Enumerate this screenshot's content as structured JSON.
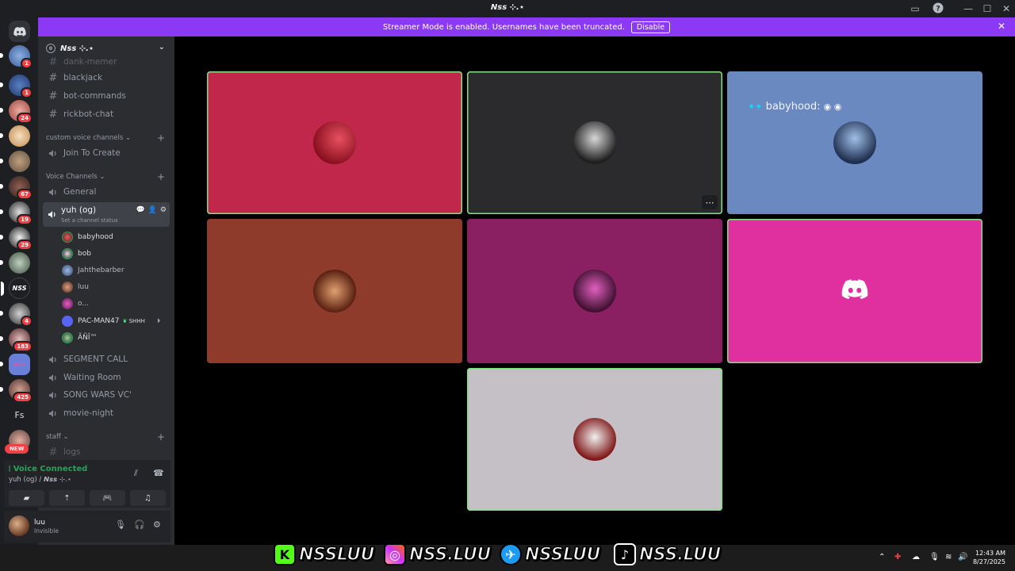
{
  "titlebar": {
    "title": "𝙉𝙨𝙨 ⊹.⋆"
  },
  "banner": {
    "text": "Streamer Mode is enabled. Usernames have been truncated.",
    "disable_label": "Disable"
  },
  "rail": {
    "badges": [
      "1",
      "1",
      "24",
      "67",
      "19",
      "29",
      "4",
      "183",
      "425"
    ],
    "fs_label": "Fs",
    "new_label": "NEW"
  },
  "guild": {
    "name": "𝙉𝙨𝙨 ⊹.⋆",
    "boost": "0"
  },
  "channels": {
    "text": [
      "dank-memer",
      "blackjack",
      "bot-commands",
      "rickbot-chat"
    ],
    "cat_custom": "custom voice channels",
    "join_to_create": "Join To Create",
    "cat_voice": "Voice Channels",
    "general": "General",
    "active_vc": "yuh (og)",
    "active_status": "Set a channel status",
    "users": [
      {
        "name": "babyhood",
        "color": "#c0392b"
      },
      {
        "name": "bob",
        "color": "#2d7d46"
      },
      {
        "name": "Jahthebarber",
        "color": "#6a8ec9"
      },
      {
        "name": "luu",
        "color": "#a0522d"
      },
      {
        "name": "o...",
        "color": "#b03a8a"
      },
      {
        "name": "PAC-MAN47",
        "color": "#5865f2"
      },
      {
        "name": "ÃÑÎ™",
        "color": "#3c8a5a"
      }
    ],
    "pacman_tag": "SHHH",
    "more_vc": [
      "SEGMENT CALL",
      "Waiting Room",
      "SONG WARS VC'",
      "movie-night"
    ],
    "cat_staff": "staff",
    "logs": "logs"
  },
  "voice_panel": {
    "title": "Voice Connected",
    "sub": "yuh (og) / 𝙉𝙨𝙨 ⊹.⋆"
  },
  "user_panel": {
    "name": "luu",
    "status": "Invisible"
  },
  "stage": {
    "caption": "babyhood:"
  },
  "tiles": [
    {
      "bg": "#c0274a",
      "speaking": true
    },
    {
      "bg": "#2b2a2d",
      "speaking": true
    },
    {
      "bg": "#6a89c0",
      "speaking": false
    },
    {
      "bg": "#8f3b2b",
      "speaking": false
    },
    {
      "bg": "#8a1f62",
      "speaking": false
    },
    {
      "bg": "#e030a0",
      "speaking": true
    },
    {
      "bg": "#c4c0c6",
      "speaking": true
    }
  ],
  "overlay": {
    "kick": "NSSLUU",
    "instagram": "NSS.LUU",
    "twitter": "NSSLUU",
    "tiktok": "NSS.LUU"
  },
  "clock": {
    "time": "12:43 AM",
    "date": "8/27/2025"
  }
}
